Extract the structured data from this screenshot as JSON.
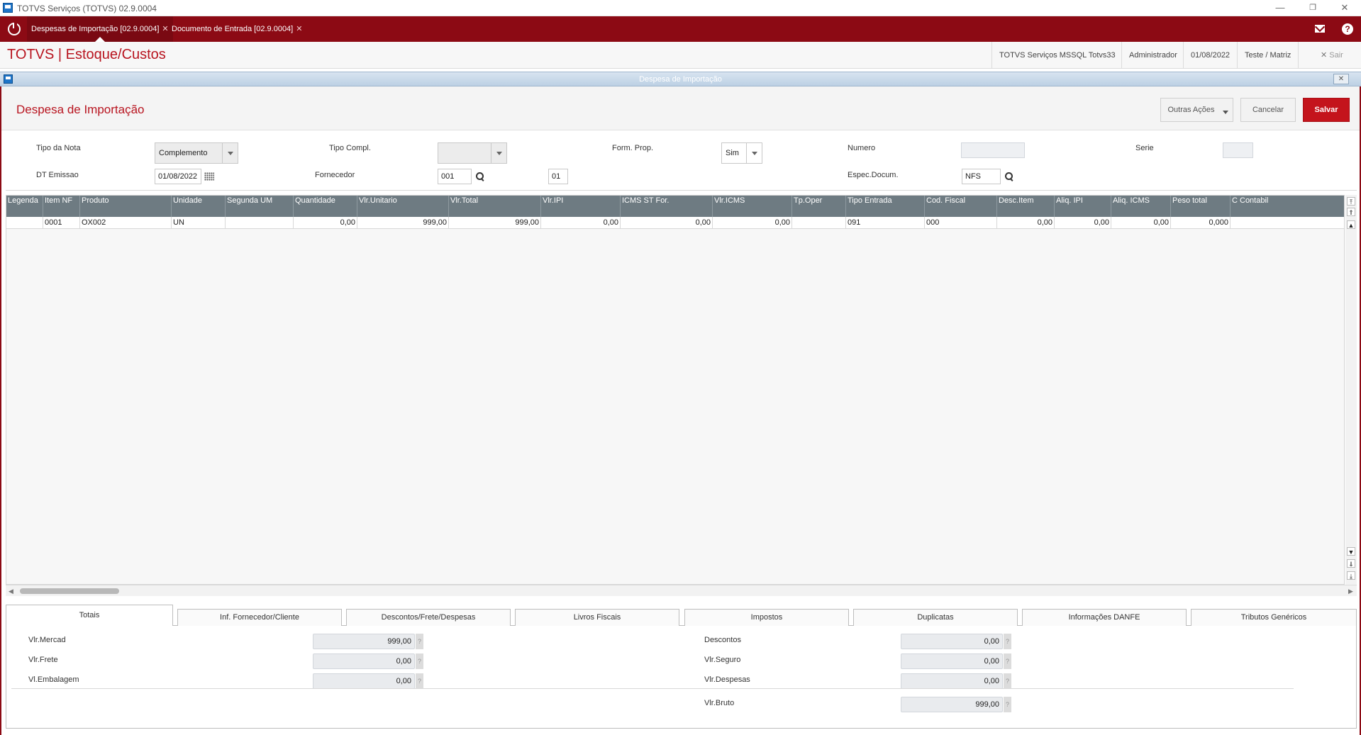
{
  "window": {
    "title": "TOTVS Serviços (TOTVS) 02.9.0004",
    "buttons": [
      "minimize",
      "restore",
      "close"
    ]
  },
  "tabs": [
    {
      "label": "Despesas de Importação [02.9.0004]",
      "active": true
    },
    {
      "label": "Documento de Entrada [02.9.0004]",
      "active": false
    }
  ],
  "header": {
    "brand": "TOTVS | Estoque/Custos",
    "environment": "TOTVS Serviços MSSQL Totvs33",
    "user": "Administrador",
    "date": "01/08/2022",
    "company": "Teste / Matriz",
    "logout": "Sair"
  },
  "dialog": {
    "title": "Despesa de Importação",
    "close": "✕"
  },
  "page": {
    "title": "Despesa de Importação",
    "actions": {
      "other": "Outras Ações",
      "cancel": "Cancelar",
      "save": "Salvar"
    }
  },
  "form": {
    "tipo_nota": {
      "label": "Tipo da Nota",
      "value": "Complemento"
    },
    "tipo_compl": {
      "label": "Tipo Compl.",
      "value": ""
    },
    "form_prop": {
      "label": "Form. Prop.",
      "value": "Sim"
    },
    "numero": {
      "label": "Numero",
      "value": ""
    },
    "serie": {
      "label": "Serie",
      "value": ""
    },
    "dt_emissao": {
      "label": "DT Emissao",
      "value": "01/08/2022"
    },
    "fornecedor": {
      "label": "Fornecedor",
      "code": "001",
      "loja": "01"
    },
    "espec_docum": {
      "label": "Espec.Docum.",
      "value": "NFS"
    }
  },
  "grid": {
    "columns": [
      "Legenda",
      "Item NF",
      "Produto",
      "Unidade",
      "Segunda UM",
      "Quantidade",
      "Vlr.Unitario",
      "Vlr.Total",
      "Vlr.IPI",
      "ICMS ST For.",
      "Vlr.ICMS",
      "Tp.Oper",
      "Tipo Entrada",
      "Cod. Fiscal",
      "Desc.Item",
      "Aliq. IPI",
      "Aliq. ICMS",
      "Peso total",
      "C Contabil"
    ],
    "rows": [
      [
        "",
        "0001",
        "OX002",
        "UN",
        "",
        "0,00",
        "999,00",
        "999,00",
        "0,00",
        "0,00",
        "0,00",
        "",
        "091",
        "000",
        "0,00",
        "0,00",
        "0,00",
        "0,000",
        ""
      ]
    ]
  },
  "bottom_tabs": [
    "Totais",
    "Inf. Fornecedor/Cliente",
    "Descontos/Frete/Despesas",
    "Livros Fiscais",
    "Impostos",
    "Duplicatas",
    "Informações DANFE",
    "Tributos Genéricos"
  ],
  "totals": {
    "vlr_mercad": {
      "label": "Vlr.Mercad",
      "value": "999,00"
    },
    "vlr_frete": {
      "label": "Vlr.Frete",
      "value": "0,00"
    },
    "vl_embalagem": {
      "label": "Vl.Embalagem",
      "value": "0,00"
    },
    "descontos": {
      "label": "Descontos",
      "value": "0,00"
    },
    "vlr_seguro": {
      "label": "Vlr.Seguro",
      "value": "0,00"
    },
    "vlr_despesas": {
      "label": "Vlr.Despesas",
      "value": "0,00"
    },
    "vlr_bruto": {
      "label": "Vlr.Bruto",
      "value": "999,00"
    },
    "help_glyph": "?"
  },
  "colors": {
    "brand_red": "#8c0a14",
    "title_red": "#b8141f",
    "save_red": "#c4141c",
    "grid_header": "#6e7b82"
  }
}
